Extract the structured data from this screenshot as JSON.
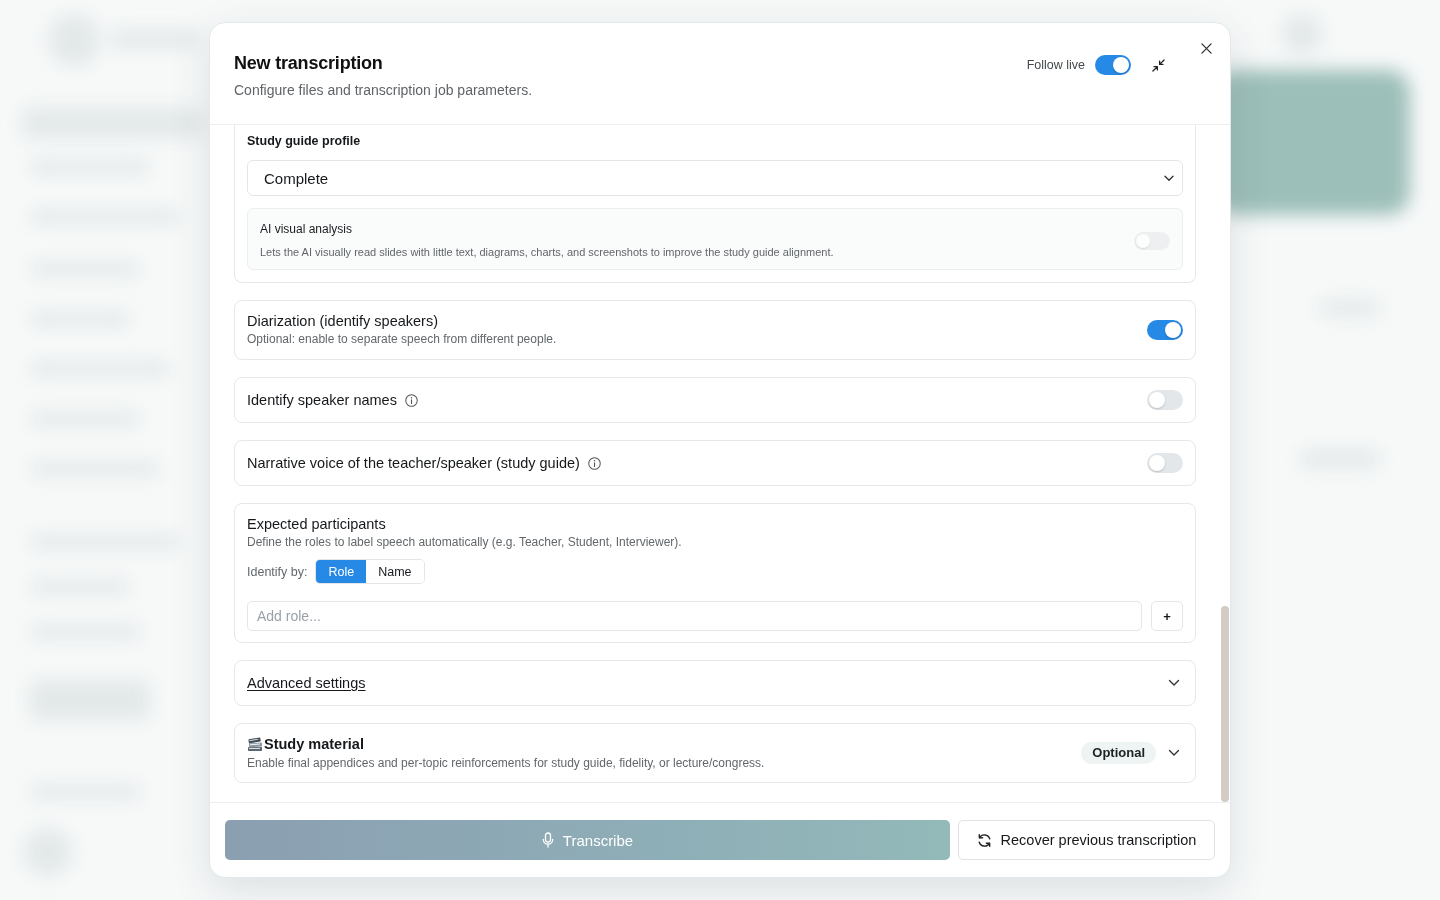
{
  "dialog": {
    "title": "New transcription",
    "subtitle": "Configure files and transcription job parameters.",
    "follow_live": {
      "label": "Follow live",
      "on": true
    }
  },
  "study_guide": {
    "profile_label": "Study guide profile",
    "profile_value": "Complete",
    "ai_visual_analysis": {
      "title": "AI visual analysis",
      "description": "Lets the AI visually read slides with little text, diagrams, charts, and screenshots to improve the study guide alignment.",
      "on": false,
      "disabled": true
    }
  },
  "options": [
    {
      "title": "Diarization (identify speakers)",
      "description": "Optional: enable to separate speech from different people.",
      "info_icon": false,
      "on": true
    },
    {
      "title": "Identify speaker names",
      "info_icon": true,
      "on": false
    },
    {
      "title": "Narrative voice of the teacher/speaker (study guide)",
      "info_icon": true,
      "on": false
    }
  ],
  "participants": {
    "title": "Expected participants",
    "description": "Define the roles to label speech automatically (e.g. Teacher, Student, Interviewer).",
    "identify_by_label": "Identify by:",
    "modes": [
      {
        "label": "Role",
        "selected": true
      },
      {
        "label": "Name",
        "selected": false
      }
    ],
    "role_input": {
      "placeholder": "Add role..."
    },
    "add_button": "+"
  },
  "advanced": {
    "title": "Advanced settings",
    "expanded": false
  },
  "study_material": {
    "title": "Study material",
    "badge": "Optional",
    "description": "Enable final appendices and per-topic reinforcements for study guide, fidelity, or lecture/congress.",
    "expanded": false
  },
  "footer": {
    "primary_button": "Transcribe",
    "secondary_button": "Recover previous transcription"
  }
}
